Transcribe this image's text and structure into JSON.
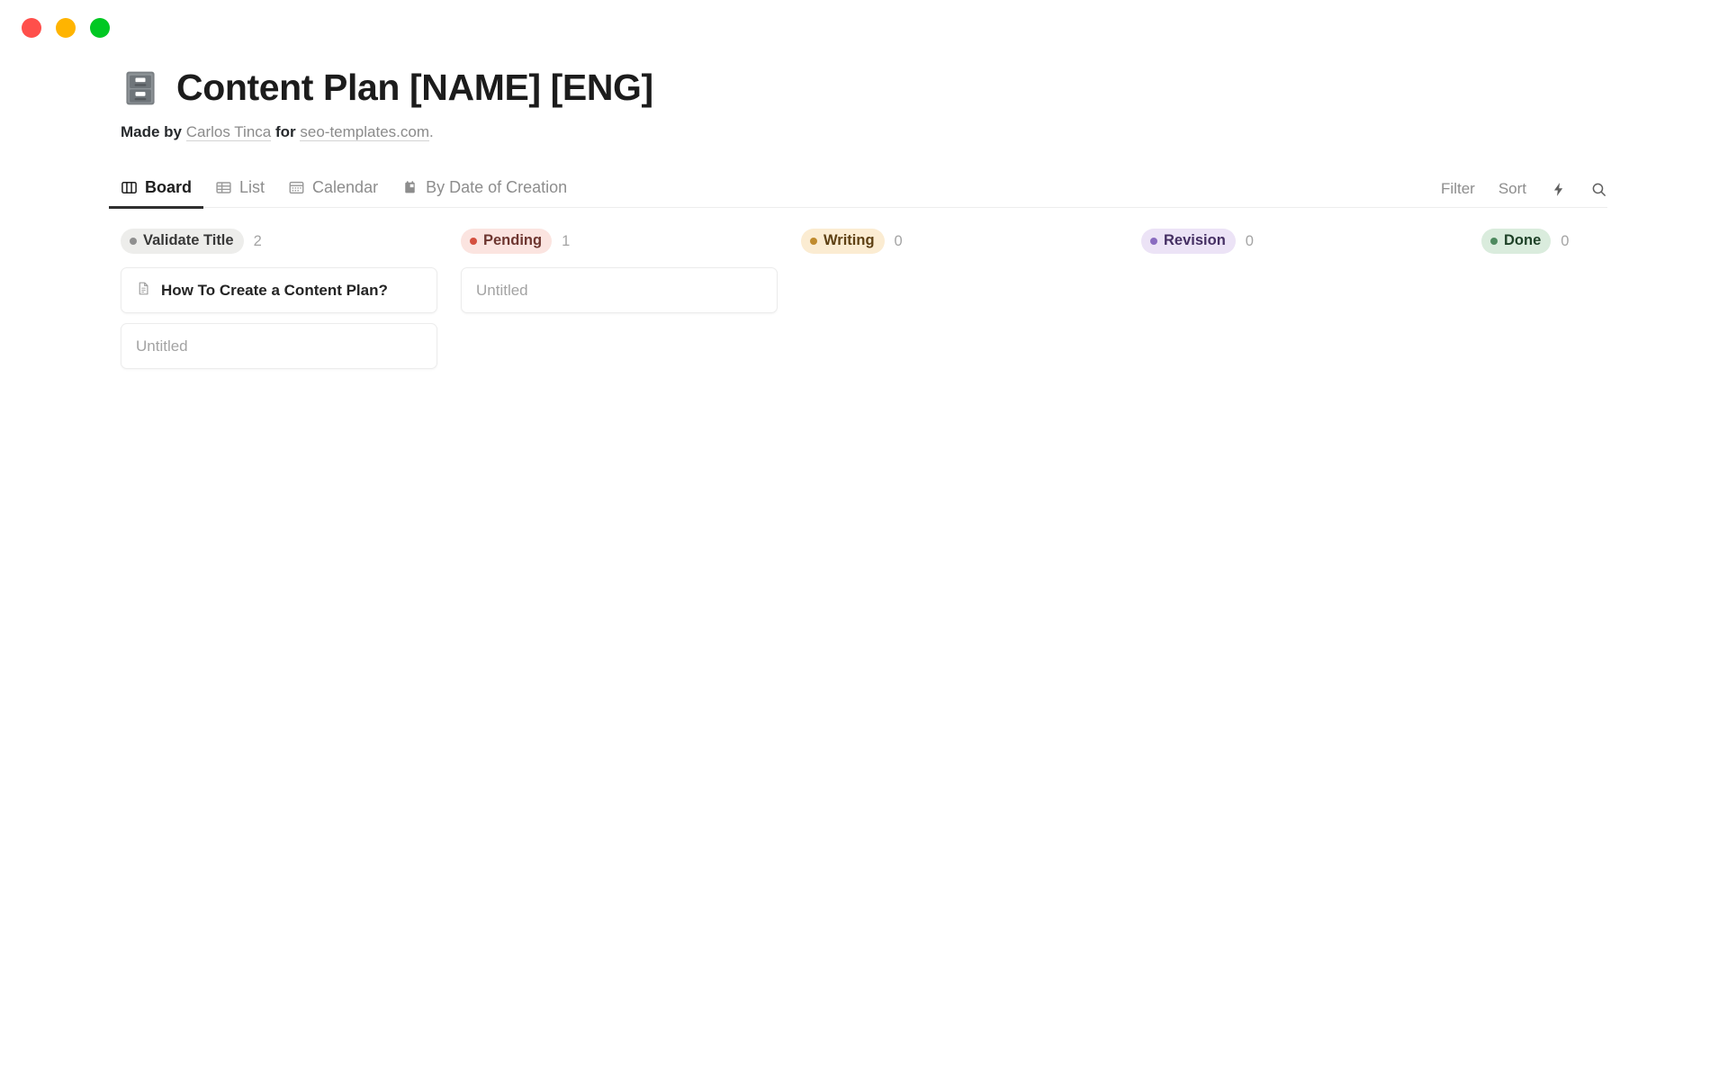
{
  "window": {
    "traffic_lights": [
      {
        "name": "close",
        "color": "#FF4F4B"
      },
      {
        "name": "minimize",
        "color": "#FFB400"
      },
      {
        "name": "maximize",
        "color": "#00C822"
      }
    ]
  },
  "header": {
    "emoji_icon": "file-cabinet-icon",
    "title": "Content Plan [NAME] [ENG]",
    "byline": {
      "made_by": "Made by",
      "author": "Carlos Tinca",
      "for": "for",
      "site": "seo-templates.com",
      "period": "."
    }
  },
  "tabs": [
    {
      "label": "Board",
      "icon": "board-icon",
      "active": true
    },
    {
      "label": "List",
      "icon": "list-icon",
      "active": false
    },
    {
      "label": "Calendar",
      "icon": "calendar-icon",
      "active": false
    },
    {
      "label": "By Date of Creation",
      "icon": "date-icon",
      "active": false
    }
  ],
  "view_actions": [
    {
      "label": "Filter",
      "icon": null,
      "type": "text"
    },
    {
      "label": "Sort",
      "icon": null,
      "type": "text"
    },
    {
      "label": "",
      "icon": "lightning-icon",
      "type": "icon"
    },
    {
      "label": "",
      "icon": "search-icon",
      "type": "icon"
    }
  ],
  "board": {
    "columns": [
      {
        "name": "Validate Title",
        "count": "2",
        "chip_bg": "#ededeb",
        "chip_text": "#383838",
        "dot_color": "#8f8f8f",
        "cards": [
          {
            "title": "How To Create a Content Plan?",
            "untitled": false,
            "icon": "document-icon"
          },
          {
            "title": "Untitled",
            "untitled": true,
            "icon": null
          }
        ]
      },
      {
        "name": "Pending",
        "count": "1",
        "chip_bg": "#fbe4e0",
        "chip_text": "#6e3630",
        "dot_color": "#d4503f",
        "cards": [
          {
            "title": "Untitled",
            "untitled": true,
            "icon": null
          }
        ]
      },
      {
        "name": "Writing",
        "count": "0",
        "chip_bg": "#fbecd2",
        "chip_text": "#5e4114",
        "dot_color": "#c08b2e",
        "cards": []
      },
      {
        "name": "Revision",
        "count": "0",
        "chip_bg": "#ece3f6",
        "chip_text": "#452f63",
        "dot_color": "#8a6cc0",
        "cards": []
      },
      {
        "name": "Done",
        "count": "0",
        "chip_bg": "#daecdd",
        "chip_text": "#1f4228",
        "dot_color": "#4e8a5f",
        "cards": []
      }
    ]
  }
}
